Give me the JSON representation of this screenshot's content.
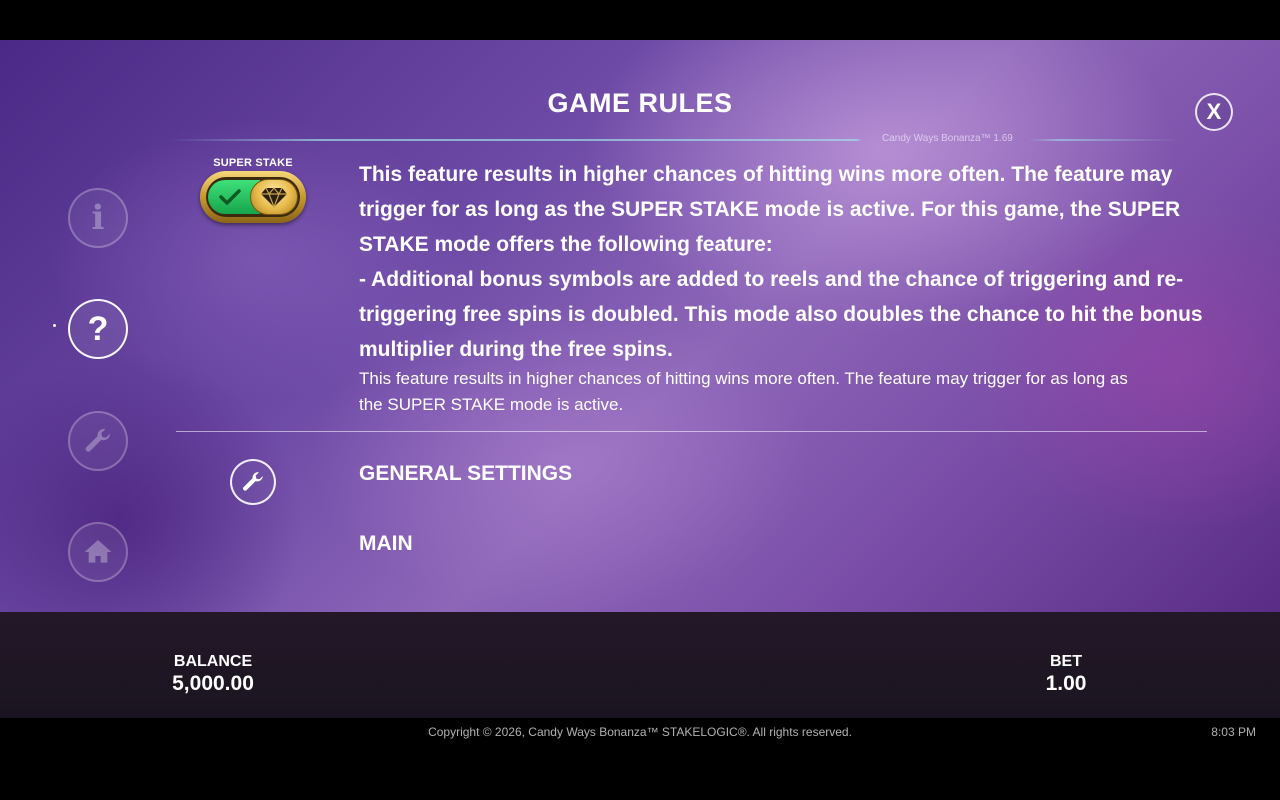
{
  "header": {
    "title": "GAME RULES",
    "version": "Candy Ways Bonanza™ 1.69",
    "close_label": "X"
  },
  "side_nav": {
    "info_glyph": "i",
    "help_glyph": "?",
    "active": "help"
  },
  "super_stake": {
    "label": "SUPER STAKE",
    "toggle_state": "on"
  },
  "rules_text": {
    "lines": [
      "This feature results in higher chances of hitting wins more often. The feature may",
      "trigger for as long as the SUPER STAKE mode is active. For this game, the SUPER",
      "STAKE mode offers the following feature:",
      "- Additional bonus symbols are added to reels and the chance of triggering and re-",
      "triggering free spins is doubled. This mode also doubles the chance to hit the bonus",
      "multiplier during the free spins."
    ],
    "small_lines": [
      "This feature results in higher chances of hitting wins more often. The feature may trigger for as long as",
      "the SUPER STAKE mode is active."
    ]
  },
  "sections": {
    "general_settings": "GENERAL SETTINGS",
    "main": "MAIN"
  },
  "bottom_bar": {
    "balance_label": "BALANCE",
    "balance_value": "5,000.00",
    "bet_label": "BET",
    "bet_value": "1.00"
  },
  "footer": {
    "copyright": "Copyright © 2026, Candy Ways Bonanza™ STAKELOGIC®. All rights reserved.",
    "time": "8:03 PM"
  },
  "colors": {
    "toggle_green": "#16a54b",
    "toggle_gold": "#c8972e",
    "background_purple": "#6d4aa6"
  }
}
